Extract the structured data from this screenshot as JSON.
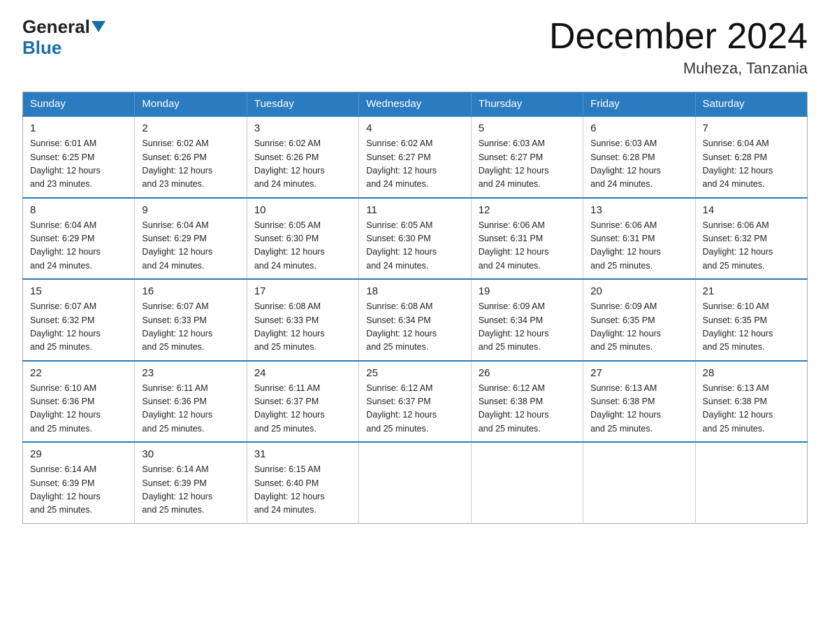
{
  "logo": {
    "general": "General",
    "blue": "Blue"
  },
  "header": {
    "month": "December 2024",
    "location": "Muheza, Tanzania"
  },
  "weekdays": [
    "Sunday",
    "Monday",
    "Tuesday",
    "Wednesday",
    "Thursday",
    "Friday",
    "Saturday"
  ],
  "weeks": [
    [
      {
        "day": "1",
        "sunrise": "6:01 AM",
        "sunset": "6:25 PM",
        "daylight": "12 hours and 23 minutes."
      },
      {
        "day": "2",
        "sunrise": "6:02 AM",
        "sunset": "6:26 PM",
        "daylight": "12 hours and 23 minutes."
      },
      {
        "day": "3",
        "sunrise": "6:02 AM",
        "sunset": "6:26 PM",
        "daylight": "12 hours and 24 minutes."
      },
      {
        "day": "4",
        "sunrise": "6:02 AM",
        "sunset": "6:27 PM",
        "daylight": "12 hours and 24 minutes."
      },
      {
        "day": "5",
        "sunrise": "6:03 AM",
        "sunset": "6:27 PM",
        "daylight": "12 hours and 24 minutes."
      },
      {
        "day": "6",
        "sunrise": "6:03 AM",
        "sunset": "6:28 PM",
        "daylight": "12 hours and 24 minutes."
      },
      {
        "day": "7",
        "sunrise": "6:04 AM",
        "sunset": "6:28 PM",
        "daylight": "12 hours and 24 minutes."
      }
    ],
    [
      {
        "day": "8",
        "sunrise": "6:04 AM",
        "sunset": "6:29 PM",
        "daylight": "12 hours and 24 minutes."
      },
      {
        "day": "9",
        "sunrise": "6:04 AM",
        "sunset": "6:29 PM",
        "daylight": "12 hours and 24 minutes."
      },
      {
        "day": "10",
        "sunrise": "6:05 AM",
        "sunset": "6:30 PM",
        "daylight": "12 hours and 24 minutes."
      },
      {
        "day": "11",
        "sunrise": "6:05 AM",
        "sunset": "6:30 PM",
        "daylight": "12 hours and 24 minutes."
      },
      {
        "day": "12",
        "sunrise": "6:06 AM",
        "sunset": "6:31 PM",
        "daylight": "12 hours and 24 minutes."
      },
      {
        "day": "13",
        "sunrise": "6:06 AM",
        "sunset": "6:31 PM",
        "daylight": "12 hours and 25 minutes."
      },
      {
        "day": "14",
        "sunrise": "6:06 AM",
        "sunset": "6:32 PM",
        "daylight": "12 hours and 25 minutes."
      }
    ],
    [
      {
        "day": "15",
        "sunrise": "6:07 AM",
        "sunset": "6:32 PM",
        "daylight": "12 hours and 25 minutes."
      },
      {
        "day": "16",
        "sunrise": "6:07 AM",
        "sunset": "6:33 PM",
        "daylight": "12 hours and 25 minutes."
      },
      {
        "day": "17",
        "sunrise": "6:08 AM",
        "sunset": "6:33 PM",
        "daylight": "12 hours and 25 minutes."
      },
      {
        "day": "18",
        "sunrise": "6:08 AM",
        "sunset": "6:34 PM",
        "daylight": "12 hours and 25 minutes."
      },
      {
        "day": "19",
        "sunrise": "6:09 AM",
        "sunset": "6:34 PM",
        "daylight": "12 hours and 25 minutes."
      },
      {
        "day": "20",
        "sunrise": "6:09 AM",
        "sunset": "6:35 PM",
        "daylight": "12 hours and 25 minutes."
      },
      {
        "day": "21",
        "sunrise": "6:10 AM",
        "sunset": "6:35 PM",
        "daylight": "12 hours and 25 minutes."
      }
    ],
    [
      {
        "day": "22",
        "sunrise": "6:10 AM",
        "sunset": "6:36 PM",
        "daylight": "12 hours and 25 minutes."
      },
      {
        "day": "23",
        "sunrise": "6:11 AM",
        "sunset": "6:36 PM",
        "daylight": "12 hours and 25 minutes."
      },
      {
        "day": "24",
        "sunrise": "6:11 AM",
        "sunset": "6:37 PM",
        "daylight": "12 hours and 25 minutes."
      },
      {
        "day": "25",
        "sunrise": "6:12 AM",
        "sunset": "6:37 PM",
        "daylight": "12 hours and 25 minutes."
      },
      {
        "day": "26",
        "sunrise": "6:12 AM",
        "sunset": "6:38 PM",
        "daylight": "12 hours and 25 minutes."
      },
      {
        "day": "27",
        "sunrise": "6:13 AM",
        "sunset": "6:38 PM",
        "daylight": "12 hours and 25 minutes."
      },
      {
        "day": "28",
        "sunrise": "6:13 AM",
        "sunset": "6:38 PM",
        "daylight": "12 hours and 25 minutes."
      }
    ],
    [
      {
        "day": "29",
        "sunrise": "6:14 AM",
        "sunset": "6:39 PM",
        "daylight": "12 hours and 25 minutes."
      },
      {
        "day": "30",
        "sunrise": "6:14 AM",
        "sunset": "6:39 PM",
        "daylight": "12 hours and 25 minutes."
      },
      {
        "day": "31",
        "sunrise": "6:15 AM",
        "sunset": "6:40 PM",
        "daylight": "12 hours and 24 minutes."
      },
      null,
      null,
      null,
      null
    ]
  ]
}
